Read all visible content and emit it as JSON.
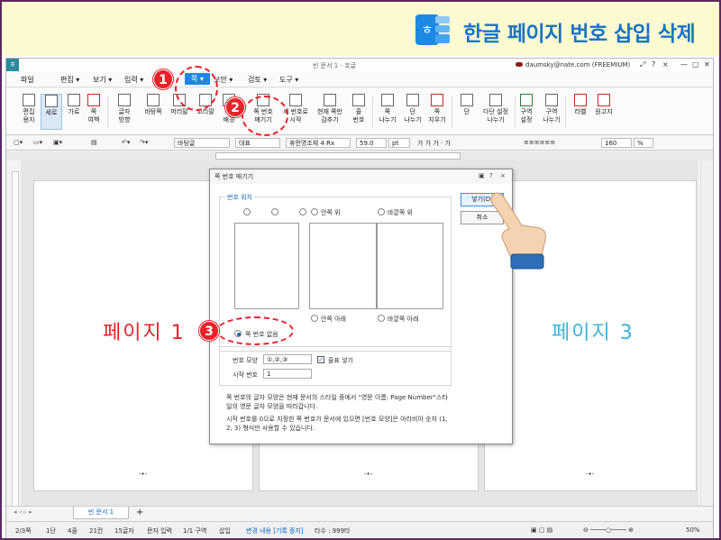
{
  "banner": {
    "title": "한글 페이지 번호 삽입 삭제",
    "icon": "hwp-logo-icon"
  },
  "window": {
    "doc_title": "빈 문서 1 - 호글",
    "user": "daumsky@nate.com (FREEMIUM)",
    "controls": [
      "⤢",
      "?",
      "×",
      "—",
      "▢",
      "✕"
    ]
  },
  "menu": {
    "items": [
      {
        "label": "파일",
        "name": "menu-file"
      },
      {
        "label": "편집 ▾",
        "name": "menu-edit"
      },
      {
        "label": "보기 ▾",
        "name": "menu-view"
      },
      {
        "label": "입력 ▾",
        "name": "menu-insert"
      },
      {
        "label": "쪽 ▾",
        "name": "menu-page"
      },
      {
        "label": "보안 ▾",
        "name": "menu-security"
      },
      {
        "label": "검토 ▾",
        "name": "menu-review"
      },
      {
        "label": "도구 ▾",
        "name": "menu-tools"
      }
    ]
  },
  "ribbon": {
    "buttons": [
      {
        "label": "편집\n용지",
        "name": "edit-paper-button"
      },
      {
        "label": "세로",
        "name": "portrait-button"
      },
      {
        "label": "가로",
        "name": "landscape-button"
      },
      {
        "label": "쪽\n여백",
        "name": "page-margin-button"
      },
      {
        "label": "글자\n방향",
        "name": "text-direction-button"
      },
      {
        "label": "바탕쪽",
        "name": "master-page-button"
      },
      {
        "label": "머리말",
        "name": "header-button"
      },
      {
        "label": "꼬리말",
        "name": "footer-button"
      },
      {
        "label": "쪽\n배경",
        "name": "page-background-button"
      },
      {
        "label": "쪽 번호\n매기기",
        "name": "page-numbering-button"
      },
      {
        "label": "새 번호로\n시작",
        "name": "new-number-button"
      },
      {
        "label": "현재 쪽만\n감추기",
        "name": "hide-current-page-button"
      },
      {
        "label": "줄\n번호",
        "name": "line-number-button"
      },
      {
        "label": "쪽\n나누기",
        "name": "page-break-button"
      },
      {
        "label": "단\n나누기",
        "name": "column-break-button"
      },
      {
        "label": "쪽\n지우기",
        "name": "delete-page-button"
      },
      {
        "label": "단",
        "name": "columns-button"
      },
      {
        "label": "다단 설정\n나누기",
        "name": "multi-column-button"
      },
      {
        "label": "구역\n설정",
        "name": "section-settings-button"
      },
      {
        "label": "구역\n나누기",
        "name": "section-break-button"
      },
      {
        "label": "라벨",
        "name": "label-button"
      },
      {
        "label": "원고지",
        "name": "manuscript-button"
      }
    ]
  },
  "format": {
    "style": "바탕글",
    "lang": "대표",
    "font": "휴먼명조체 4 Rx",
    "size": "59.0",
    "unit": "pt",
    "zoom": "160",
    "zoom_unit": "%"
  },
  "pages": {
    "page1": "페이지 1",
    "page3": "페이지 3",
    "page1_color": "#e8222b",
    "page3_color": "#3cb4d8",
    "page_mark": "-•-"
  },
  "dialog": {
    "title": "쪽 번호 매기기",
    "controls": [
      "▣",
      "?",
      "×"
    ],
    "position_group": "번호 위치",
    "pos_left_top": "안쪽 위",
    "pos_right_top": "바깥쪽 위",
    "pos_left_bottom": "안쪽 아래",
    "pos_right_bottom": "바깥쪽 아래",
    "no_number": "쪽 번호 없음",
    "options_group": "번호 모양",
    "shape_label": "번호 모양",
    "shape_value": "①,②,③",
    "include_label": "줄표 넣기",
    "start_label": "시작 번호",
    "start_value": "1",
    "note1": "쪽 번호의 글자 모양은 현재 문서의 스타일 중에서 \"영문 이름: Page Number\"스타일의 영문 글자 모양을 따라갑니다.",
    "note2": "시작 번호를 0으로 지정한 쪽 번호가 문서에 있으면 [번호 모양]은 아라비아 숫자 (1, 2, 3) 형식만 사용할 수 있습니다.",
    "insert_btn": "넣기(D)",
    "cancel_btn": "취소"
  },
  "tabs": {
    "doc_tab": "빈 문서 1",
    "add": "+"
  },
  "status": {
    "page": "2/3쪽",
    "column": "1단",
    "line": "4줄",
    "col": "21칸",
    "chars": "15글자",
    "input_mode": "문자 입력",
    "section": "1/1 구역",
    "insert": "삽입",
    "track": "변경 내용 [기록 중지]",
    "count": "타수 : 999타",
    "zoom": "50%"
  },
  "annotations": {
    "badge1": "1",
    "badge2": "2",
    "badge3": "3",
    "color": "#e8222b"
  }
}
